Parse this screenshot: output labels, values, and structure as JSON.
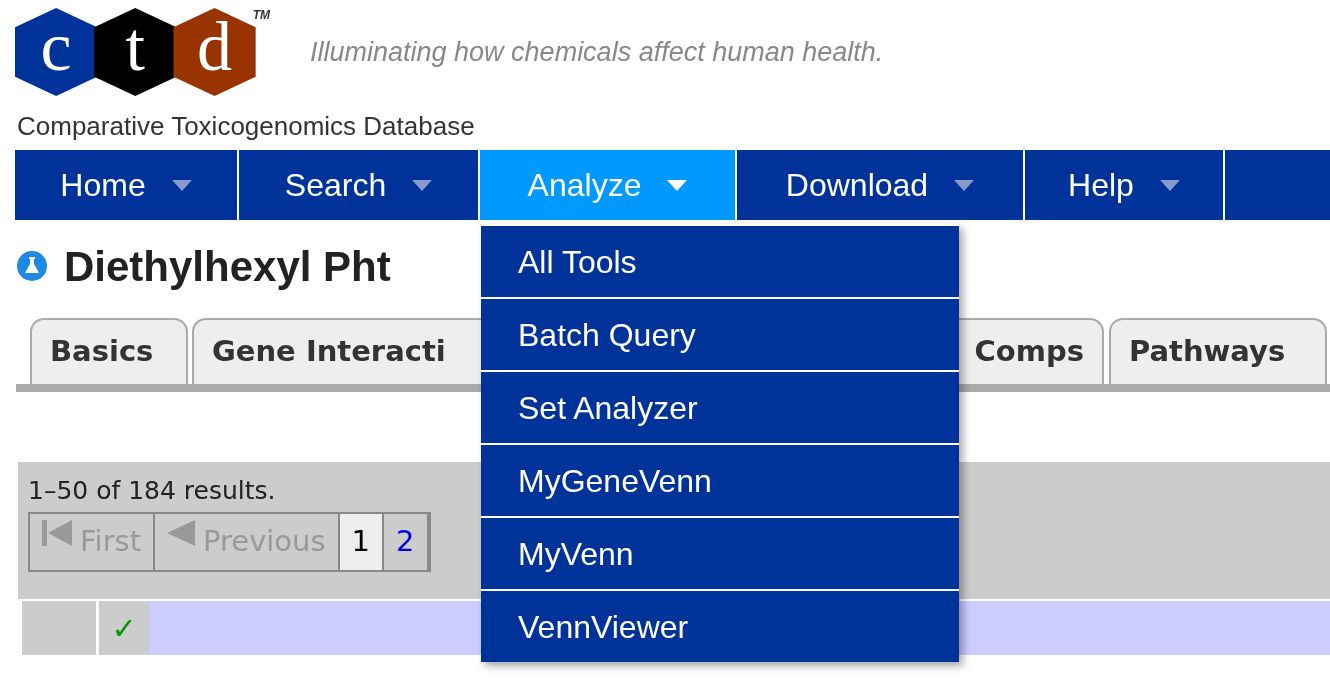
{
  "logo": {
    "letters": [
      "c",
      "t",
      "d"
    ],
    "trademark": "TM"
  },
  "tagline": "Illuminating how chemicals affect human health.",
  "site_name": "Comparative Toxicogenomics Database",
  "nav": [
    {
      "label": "Home",
      "selected": false
    },
    {
      "label": "Search",
      "selected": false
    },
    {
      "label": "Analyze",
      "selected": true
    },
    {
      "label": "Download",
      "selected": false
    },
    {
      "label": "Help",
      "selected": false
    }
  ],
  "dropdown": {
    "items": [
      "All Tools",
      "Batch Query",
      "Set Analyzer",
      "MyGeneVenn",
      "MyVenn",
      "VennViewer"
    ]
  },
  "page_title": "Diethylhexyl Pht",
  "tabs": [
    {
      "label": "Basics",
      "selected": false
    },
    {
      "label": "Gene Interacti",
      "selected": false
    },
    {
      "label": "Comps",
      "selected": false
    },
    {
      "label": "Pathways",
      "selected": false
    }
  ],
  "results": {
    "summary": "1–50 of 184 results.",
    "pager": [
      {
        "label": "First",
        "kind": "first",
        "disabled": true,
        "selected": false
      },
      {
        "label": "Previous",
        "kind": "prev",
        "disabled": true,
        "selected": false
      },
      {
        "label": "1",
        "kind": "page",
        "disabled": false,
        "selected": true
      },
      {
        "label": "2",
        "kind": "page",
        "disabled": false,
        "selected": false
      }
    ]
  },
  "table": {
    "header_check": "✓"
  }
}
